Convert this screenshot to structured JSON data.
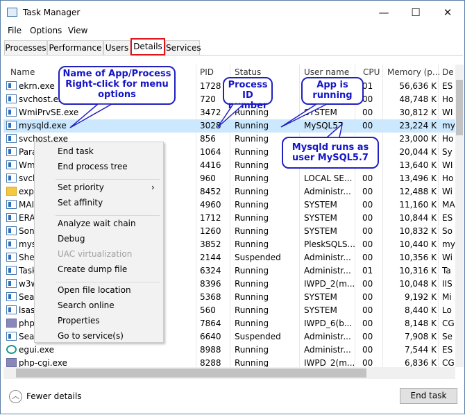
{
  "window": {
    "title": "Task Manager",
    "minimize": "—",
    "maximize": "☐",
    "close": "✕"
  },
  "menubar": [
    "File",
    "Options",
    "View"
  ],
  "tabs": [
    {
      "label": "Processes"
    },
    {
      "label": "Performance"
    },
    {
      "label": "Users"
    },
    {
      "label": "Details",
      "selected": true
    },
    {
      "label": "Services"
    }
  ],
  "columns": [
    "Name",
    "PID",
    "Status",
    "User name",
    "CPU",
    "Memory (p...",
    "De"
  ],
  "rows": [
    {
      "icon": "app",
      "name": "ekrn.exe",
      "pid": "1728",
      "status": "",
      "user": "",
      "cpu": "01",
      "mem": "56,636 K",
      "desc": "ES"
    },
    {
      "icon": "app",
      "name": "svchost.exe",
      "pid": "720",
      "status": "",
      "user": "",
      "cpu": "00",
      "mem": "48,748 K",
      "desc": "Ho"
    },
    {
      "icon": "wmi",
      "name": "WmiPrvSE.exe",
      "pid": "3472",
      "status": "Running",
      "user": "SYSTEM",
      "cpu": "00",
      "mem": "30,812 K",
      "desc": "WI"
    },
    {
      "icon": "app",
      "name": "mysqld.exe",
      "pid": "3028",
      "status": "Running",
      "user": "MySQL57",
      "cpu": "00",
      "mem": "23,224 K",
      "desc": "my",
      "selected": true
    },
    {
      "icon": "app",
      "name": "svchost.exe",
      "pid": "856",
      "status": "Running",
      "user": "",
      "cpu": "",
      "mem": "23,000 K",
      "desc": "Ho"
    },
    {
      "icon": "app",
      "name": "Para",
      "pid": "1064",
      "status": "Running",
      "user": "",
      "cpu": "",
      "mem": "20,044 K",
      "desc": "Sy"
    },
    {
      "icon": "wmi",
      "name": "Wm",
      "pid": "4416",
      "status": "Running",
      "user": "",
      "cpu": "",
      "mem": "13,640 K",
      "desc": "WI"
    },
    {
      "icon": "app",
      "name": "svch",
      "pid": "960",
      "status": "Running",
      "user": "LOCAL SE...",
      "cpu": "00",
      "mem": "13,496 K",
      "desc": "Ho"
    },
    {
      "icon": "folder",
      "name": "expl",
      "pid": "8452",
      "status": "Running",
      "user": "Administr...",
      "cpu": "00",
      "mem": "12,488 K",
      "desc": "Wi"
    },
    {
      "icon": "app",
      "name": "MAI",
      "pid": "4960",
      "status": "Running",
      "user": "SYSTEM",
      "cpu": "00",
      "mem": "11,160 K",
      "desc": "MA"
    },
    {
      "icon": "app",
      "name": "ERA",
      "pid": "1712",
      "status": "Running",
      "user": "SYSTEM",
      "cpu": "00",
      "mem": "10,844 K",
      "desc": "ES"
    },
    {
      "icon": "app",
      "name": "Son",
      "pid": "1260",
      "status": "Running",
      "user": "SYSTEM",
      "cpu": "00",
      "mem": "10,832 K",
      "desc": "So"
    },
    {
      "icon": "app",
      "name": "mys",
      "pid": "3852",
      "status": "Running",
      "user": "PleskSQLS...",
      "cpu": "00",
      "mem": "10,440 K",
      "desc": "my"
    },
    {
      "icon": "app",
      "name": "Shel",
      "pid": "2144",
      "status": "Suspended",
      "user": "Administr...",
      "cpu": "00",
      "mem": "10,356 K",
      "desc": "Wi"
    },
    {
      "icon": "app",
      "name": "Task",
      "pid": "6324",
      "status": "Running",
      "user": "Administr...",
      "cpu": "01",
      "mem": "10,316 K",
      "desc": "Ta"
    },
    {
      "icon": "app",
      "name": "w3w",
      "pid": "8396",
      "status": "Running",
      "user": "IWPD_2(m...",
      "cpu": "00",
      "mem": "10,048 K",
      "desc": "IIS"
    },
    {
      "icon": "app",
      "name": "Sear",
      "pid": "5368",
      "status": "Running",
      "user": "SYSTEM",
      "cpu": "00",
      "mem": "9,192 K",
      "desc": "Mi"
    },
    {
      "icon": "app",
      "name": "lsass",
      "pid": "560",
      "status": "Running",
      "user": "SYSTEM",
      "cpu": "00",
      "mem": "8,440 K",
      "desc": "Lo"
    },
    {
      "icon": "php",
      "name": "php",
      "pid": "7864",
      "status": "Running",
      "user": "IWPD_6(b...",
      "cpu": "00",
      "mem": "8,148 K",
      "desc": "CG"
    },
    {
      "icon": "app",
      "name": "Sear",
      "pid": "6640",
      "status": "Suspended",
      "user": "Administr...",
      "cpu": "00",
      "mem": "7,908 K",
      "desc": "Se"
    },
    {
      "icon": "e",
      "name": "egui.exe",
      "pid": "8988",
      "status": "Running",
      "user": "Administr...",
      "cpu": "00",
      "mem": "7,544 K",
      "desc": "ES"
    },
    {
      "icon": "php",
      "name": "php-cgi.exe",
      "pid": "8288",
      "status": "Running",
      "user": "IWPD_2(m...",
      "cpu": "00",
      "mem": "6,836 K",
      "desc": "CG"
    }
  ],
  "context_menu": [
    {
      "label": "End task"
    },
    {
      "label": "End process tree"
    },
    {
      "sep": true
    },
    {
      "label": "Set priority",
      "submenu": true
    },
    {
      "label": "Set affinity"
    },
    {
      "sep": true
    },
    {
      "label": "Analyze wait chain"
    },
    {
      "label": "Debug"
    },
    {
      "label": "UAC virtualization",
      "disabled": true
    },
    {
      "label": "Create dump file"
    },
    {
      "sep": true
    },
    {
      "label": "Open file location"
    },
    {
      "label": "Search online"
    },
    {
      "label": "Properties"
    },
    {
      "label": "Go to service(s)"
    }
  ],
  "submenu_arrow": "›",
  "callouts": {
    "name": "Name of App/Process Right-click for menu options",
    "pid": "Process ID number",
    "running": "App is running",
    "user": "Mysqld runs as user MySQL5.7"
  },
  "footer": {
    "fewer_details": "Fewer details",
    "fewer_icon": "︿",
    "end_task": "End task"
  }
}
